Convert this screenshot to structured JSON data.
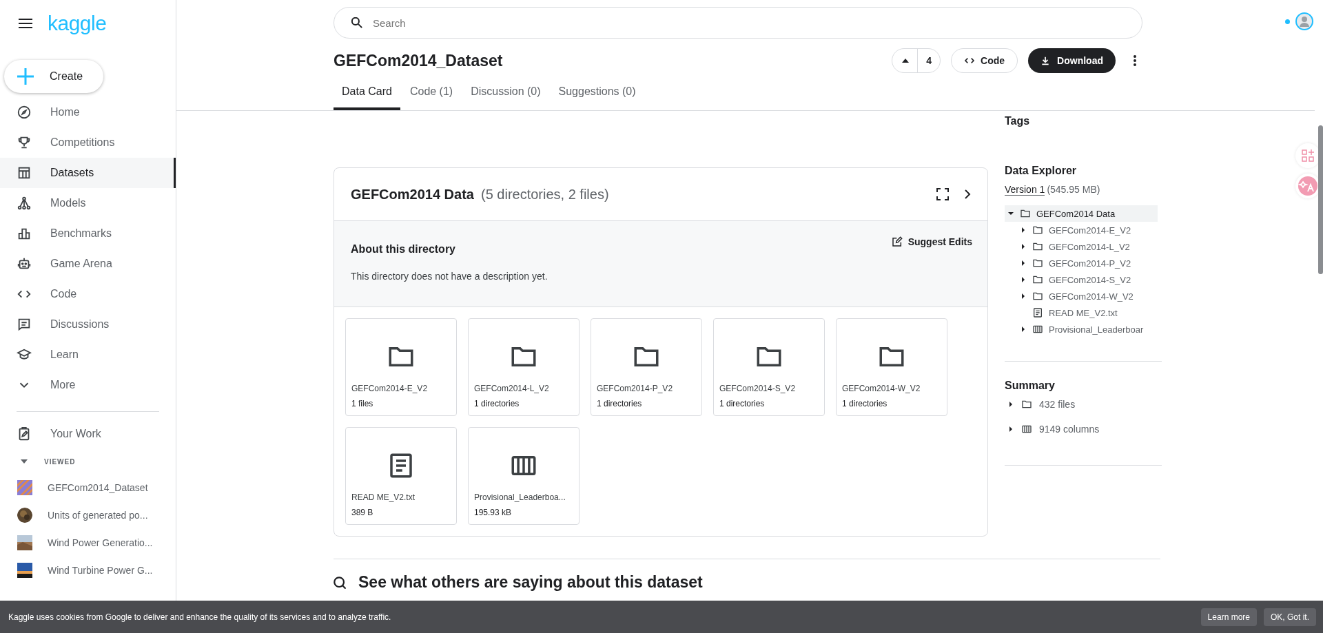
{
  "sidebar": {
    "logo": "kaggle",
    "create": "Create",
    "nav": [
      {
        "label": "Home",
        "selected": false
      },
      {
        "label": "Competitions",
        "selected": false
      },
      {
        "label": "Datasets",
        "selected": true
      },
      {
        "label": "Models",
        "selected": false
      },
      {
        "label": "Benchmarks",
        "selected": false
      },
      {
        "label": "Game Arena",
        "selected": false
      },
      {
        "label": "Code",
        "selected": false
      },
      {
        "label": "Discussions",
        "selected": false
      },
      {
        "label": "Learn",
        "selected": false
      },
      {
        "label": "More",
        "selected": false
      }
    ],
    "your_work": "Your Work",
    "viewed_heading": "VIEWED",
    "viewed_expanded": true,
    "viewed": [
      {
        "label": "GEFCom2014_Dataset"
      },
      {
        "label": "Units of generated po..."
      },
      {
        "label": "Wind Power Generatio..."
      },
      {
        "label": "Wind Turbine Power G..."
      }
    ]
  },
  "search": {
    "placeholder": "Search"
  },
  "dataset": {
    "title": "GEFCom2014_Dataset",
    "votes": "4",
    "code_button": "Code",
    "download_button": "Download"
  },
  "tabs": [
    {
      "label": "Data Card",
      "selected": true
    },
    {
      "label": "Code (1)",
      "selected": false
    },
    {
      "label": "Discussion (0)",
      "selected": false
    },
    {
      "label": "Suggestions (0)",
      "selected": false
    }
  ],
  "card": {
    "title": "GEFCom2014 Data",
    "subtitle": "(5 directories, 2 files)",
    "about_title": "About this directory",
    "suggest_edits": "Suggest Edits",
    "description": "This directory does not have a description yet.",
    "tiles": [
      {
        "kind": "folder",
        "name": "GEFCom2014-E_V2",
        "meta": "1 files"
      },
      {
        "kind": "folder",
        "name": "GEFCom2014-L_V2",
        "meta": "1 directories"
      },
      {
        "kind": "folder",
        "name": "GEFCom2014-P_V2",
        "meta": "1 directories"
      },
      {
        "kind": "folder",
        "name": "GEFCom2014-S_V2",
        "meta": "1 directories"
      },
      {
        "kind": "folder",
        "name": "GEFCom2014-W_V2",
        "meta": "1 directories"
      },
      {
        "kind": "file",
        "name": "READ ME_V2.txt",
        "meta": "389 B"
      },
      {
        "kind": "table",
        "name": "Provisional_Leaderboa...",
        "meta": "195.93 kB"
      }
    ]
  },
  "discussion_heading": "See what others are saying about this dataset",
  "right": {
    "tags_title": "Tags",
    "explorer_title": "Data Explorer",
    "version": "Version 1",
    "size": "(545.95 MB)",
    "tree": [
      {
        "kind": "folder",
        "name": "GEFCom2014 Data",
        "expanded": true,
        "selected": true,
        "children": [
          {
            "kind": "folder",
            "name": "GEFCom2014-E_V2",
            "expanded": false,
            "selected": false
          },
          {
            "kind": "folder",
            "name": "GEFCom2014-L_V2",
            "expanded": false,
            "selected": false
          },
          {
            "kind": "folder",
            "name": "GEFCom2014-P_V2",
            "expanded": false,
            "selected": false
          },
          {
            "kind": "folder",
            "name": "GEFCom2014-S_V2",
            "expanded": false,
            "selected": false
          },
          {
            "kind": "folder",
            "name": "GEFCom2014-W_V2",
            "expanded": false,
            "selected": false
          },
          {
            "kind": "file",
            "name": "READ ME_V2.txt",
            "selected": false
          },
          {
            "kind": "table",
            "name": "Provisional_Leaderboar",
            "expanded": false,
            "selected": false
          }
        ]
      }
    ],
    "summary_title": "Summary",
    "summary": [
      {
        "kind": "folder",
        "label": "432 files",
        "expanded": false
      },
      {
        "kind": "table",
        "label": "9149 columns",
        "expanded": false
      }
    ]
  },
  "cookie": {
    "text": "Kaggle uses cookies from Google to deliver and enhance the quality of its services and to analyze traffic.",
    "learn_more": "Learn more",
    "ok": "OK, Got it."
  }
}
